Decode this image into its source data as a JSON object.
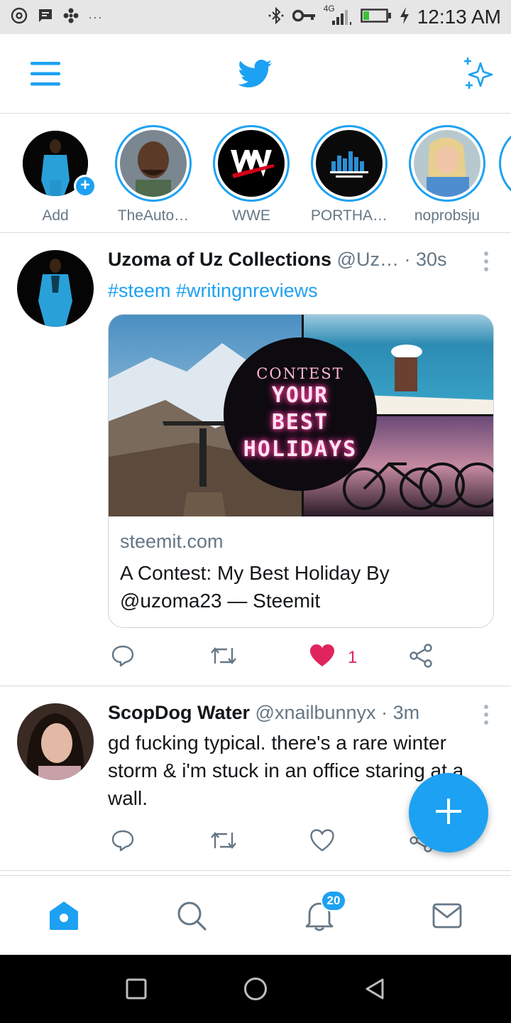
{
  "status_bar": {
    "time": "12:13 AM",
    "network": "4G",
    "icons": [
      "vinyl-icon",
      "message-icon",
      "fan-icon",
      "bluetooth-icon",
      "key-icon",
      "signal-icon",
      "battery-icon",
      "charging-icon"
    ]
  },
  "app_bar": {
    "menu_icon": "hamburger-icon",
    "logo_icon": "twitter-bird-icon",
    "sparkle_icon": "sparkle-icon"
  },
  "fleets": [
    {
      "label": "Add"
    },
    {
      "label": "TheAuto…"
    },
    {
      "label": "WWE"
    },
    {
      "label": "PORTHA…"
    },
    {
      "label": "noprobsju"
    }
  ],
  "tweets": [
    {
      "name": "Uzoma of Uz Collections",
      "handle": "@Uz…",
      "separator": "·",
      "time": "30s",
      "hashtags": "#steem #writingnreviews",
      "card": {
        "image_text_top": "CONTEST",
        "image_text_lines": [
          "YOUR",
          "BEST",
          "HOLIDAYS"
        ],
        "domain": "steemit.com",
        "title": "A Contest: My Best Holiday By @uzoma23 — Steemit"
      },
      "likes": "1",
      "liked": true
    },
    {
      "name": "ScopDog Water",
      "handle": "@xnailbunnyx",
      "separator": "·",
      "time": "3m",
      "text": "gd fucking typical. there's a rare winter storm & i'm stuck in an office staring at a wall.",
      "likes": "",
      "liked": false
    }
  ],
  "bottom_nav": {
    "items": [
      "home-icon",
      "search-icon",
      "notifications-icon",
      "messages-icon"
    ],
    "notifications_badge": "20"
  },
  "colors": {
    "accent": "#1da1f2",
    "like": "#e0245e",
    "secondary_text": "#657786"
  }
}
